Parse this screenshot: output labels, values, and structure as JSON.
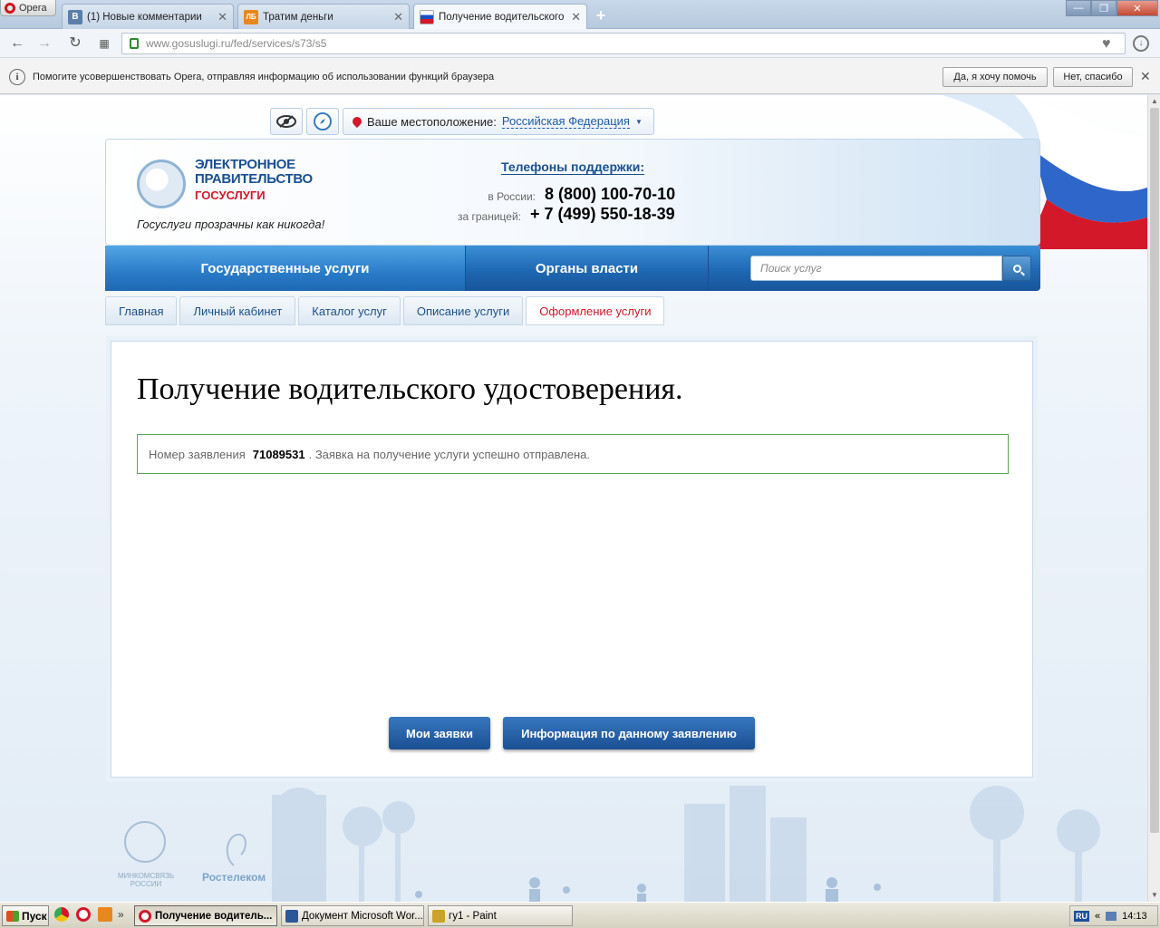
{
  "browser": {
    "menu_label": "Opera",
    "tabs": [
      {
        "favicon": "В",
        "favicon_color": "#5a7fa8",
        "label": "(1) Новые комментарии"
      },
      {
        "favicon": "ЛБ",
        "favicon_color": "#e8871e",
        "label": "Тратим деньги"
      },
      {
        "favicon": "",
        "favicon_color": "#ffffff",
        "label": "Получение водительского"
      }
    ],
    "url_host": "www.gosuslugi.ru",
    "url_path": "/fed/services/s73/s5",
    "infobar": {
      "text": "Помогите усовершенствовать Opera, отправляя информацию об использовании функций браузера",
      "accept_label": "Да, я хочу помочь",
      "decline_label": "Нет, спасибо"
    }
  },
  "site": {
    "location_label": "Ваше местоположение:",
    "location_value": "Российская Федерация",
    "logo_title_1": "ЭЛЕКТРОННОЕ",
    "logo_title_2": "ПРАВИТЕЛЬСТВО",
    "logo_sub": "ГОСУСЛУГИ",
    "slogan": "Госуслуги прозрачны как никогда!",
    "support_title": "Телефоны поддержки:",
    "phone_russia_label": "в России:",
    "phone_russia": "8 (800) 100-70-10",
    "phone_abroad_label": "за границей:",
    "phone_abroad": "+ 7 (499) 550-18-39",
    "nav": {
      "services": "Государственные услуги",
      "authorities": "Органы власти",
      "search_placeholder": "Поиск услуг"
    },
    "breadcrumbs": [
      "Главная",
      "Личный кабинет",
      "Каталог услуг",
      "Описание услуги",
      "Оформление услуги"
    ],
    "page_title": "Получение водительского удостоверения.",
    "message": {
      "prefix": "Номер заявления",
      "number": "71089531",
      "suffix": ". Заявка на получение услуги успешно отправлена."
    },
    "buttons": {
      "my_requests": "Мои заявки",
      "request_info": "Информация по данному заявлению"
    },
    "footer": {
      "ministry_line1": "МИНКОМСВЯЗЬ",
      "ministry_line2": "РОССИИ",
      "rostelecom": "Ростелеком"
    }
  },
  "taskbar": {
    "start_label": "Пуск",
    "tasks": [
      {
        "label": "Получение водитель...",
        "icon_color": "#d3182a"
      },
      {
        "label": "Документ Microsoft Wor...",
        "icon_color": "#2b5797"
      },
      {
        "label": "гу1 - Paint",
        "icon_color": "#c9a227"
      }
    ],
    "lang": "RU",
    "clock": "14:13"
  }
}
